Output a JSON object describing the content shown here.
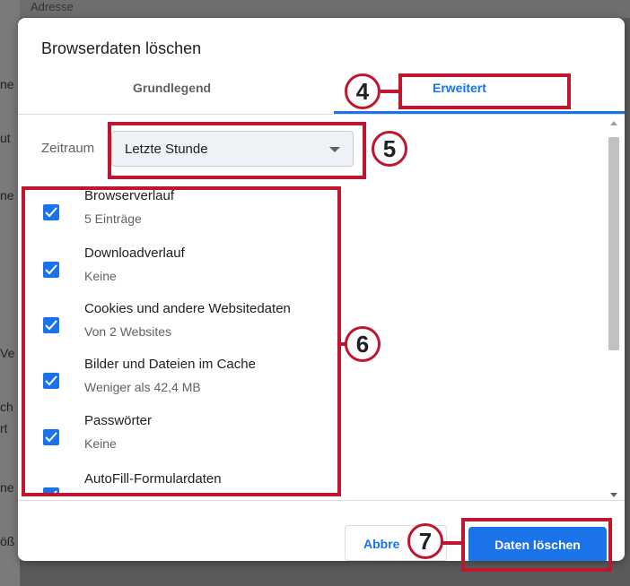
{
  "background": {
    "fragments": [
      "Adresse",
      "ne",
      "ut",
      "ne",
      "Ve",
      "ch",
      "rt",
      "ne",
      "öß"
    ]
  },
  "dialog": {
    "title": "Browserdaten löschen",
    "tabs": [
      {
        "label": "Grundlegend",
        "active": false
      },
      {
        "label": "Erweitert",
        "active": true
      }
    ],
    "time_range": {
      "label": "Zeitraum",
      "value": "Letzte Stunde"
    },
    "items": [
      {
        "label": "Browserverlauf",
        "detail": "5 Einträge",
        "checked": true
      },
      {
        "label": "Downloadverlauf",
        "detail": "Keine",
        "checked": true
      },
      {
        "label": "Cookies und andere Websitedaten",
        "detail": "Von 2 Websites",
        "checked": true
      },
      {
        "label": "Bilder und Dateien im Cache",
        "detail": "Weniger als 42,4 MB",
        "checked": true
      },
      {
        "label": "Passwörter",
        "detail": "Keine",
        "checked": true
      },
      {
        "label": "AutoFill-Formulardaten",
        "detail": "",
        "checked": true
      }
    ],
    "buttons": {
      "cancel": "Abbre",
      "delete": "Daten löschen"
    }
  },
  "annotations": [
    "4",
    "5",
    "6",
    "7"
  ],
  "colors": {
    "accent": "#1a73e8",
    "annotation": "#c0152f"
  }
}
